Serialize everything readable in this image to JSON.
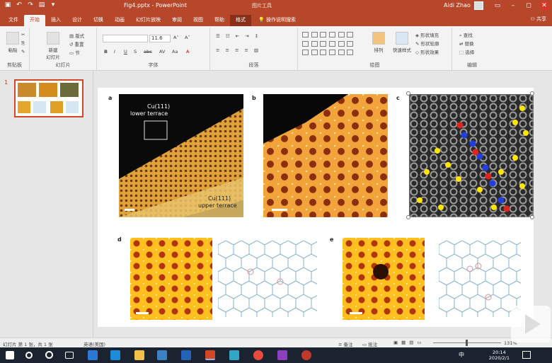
{
  "window": {
    "title": "Fig4.pptx - PowerPoint",
    "context_tool": "图片工具",
    "user": "Aidi Zhao"
  },
  "tabs": [
    "文件",
    "开始",
    "插入",
    "设计",
    "切换",
    "动画",
    "幻灯片放映",
    "审阅",
    "视图",
    "帮助",
    "格式"
  ],
  "active_tab": "开始",
  "tell_me": "操作说明搜索",
  "share": "共享",
  "ribbon": {
    "clipboard": {
      "label": "剪贴板",
      "paste": "粘贴"
    },
    "slides": {
      "label": "幻灯片",
      "new_slide": "新建\n幻灯片",
      "layout": "版式",
      "reset": "重置",
      "section": "节"
    },
    "font": {
      "label": "字体",
      "size": "11.6"
    },
    "paragraph": {
      "label": "段落"
    },
    "drawing": {
      "label": "绘图",
      "arrange": "排列",
      "quick_styles": "快速样式",
      "fill": "形状填充",
      "outline": "形状轮廓",
      "effects": "形状效果"
    },
    "editing": {
      "label": "编辑",
      "find": "查找",
      "replace": "替换",
      "select": "选择"
    }
  },
  "slide_panel": {
    "number": "1"
  },
  "slide": {
    "panels": [
      "a",
      "b",
      "c",
      "d",
      "e"
    ],
    "annot_lower": "Cu(111)\nlower terrace",
    "annot_upper": "Cu(111)\nupper terrace"
  },
  "status": {
    "left": "幻灯片 第 1 张，共 1 张",
    "lang": "英语(美国)",
    "notes": "备注",
    "comments": "批注",
    "zoom": "131%"
  },
  "taskbar": {
    "time": "20:14",
    "date": "2020/2/1",
    "ime": "中"
  },
  "colors": {
    "accent": "#b7472a",
    "taskbar": "#1c2330"
  }
}
